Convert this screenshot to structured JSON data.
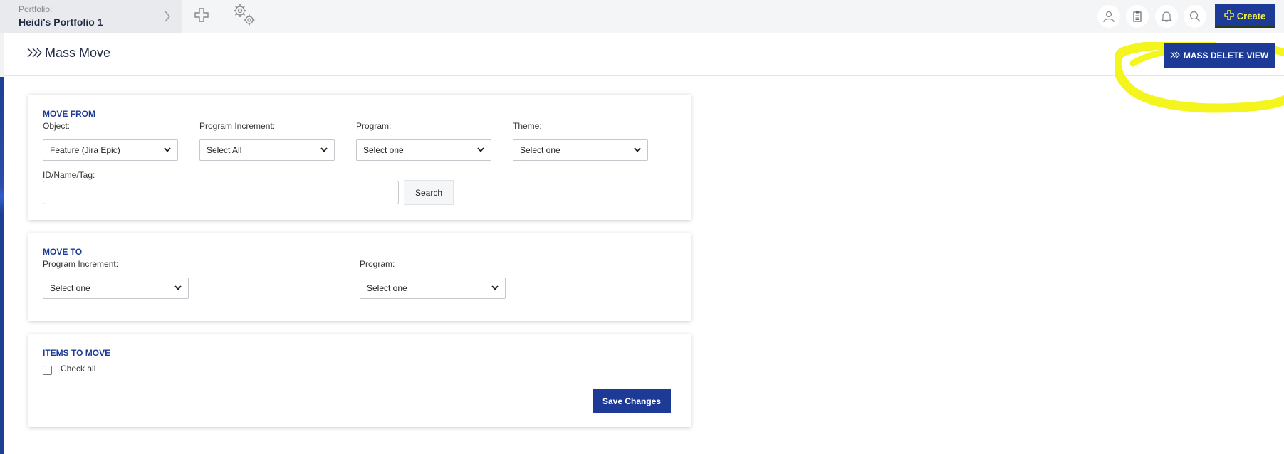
{
  "topbar": {
    "portfolio_label": "Portfolio:",
    "portfolio_name": "Heidi's Portfolio 1",
    "create_label": "Create",
    "icons": [
      "chevron-right-icon",
      "plus-icon",
      "gears-icon",
      "user-icon",
      "clipboard-icon",
      "bell-icon",
      "search-icon"
    ]
  },
  "header": {
    "title": "Mass Move",
    "mass_delete_label": "MASS DELETE VIEW"
  },
  "move_from": {
    "title": "MOVE FROM",
    "object_label": "Object:",
    "object_value": "Feature (Jira Epic)",
    "pi_label": "Program Increment:",
    "pi_value": "Select All",
    "program_label": "Program:",
    "program_value": "Select one",
    "theme_label": "Theme:",
    "theme_value": "Select one",
    "id_label": "ID/Name/Tag:",
    "id_value": "",
    "search_label": "Search"
  },
  "move_to": {
    "title": "MOVE TO",
    "pi_label": "Program Increment:",
    "pi_value": "Select one",
    "program_label": "Program:",
    "program_value": "Select one"
  },
  "items": {
    "title": "ITEMS TO MOVE",
    "check_all_label": "Check all",
    "save_label": "Save Changes"
  },
  "colors": {
    "accent": "#1d3b96",
    "highlight": "#f5f51e",
    "create_text": "#f5f542"
  }
}
